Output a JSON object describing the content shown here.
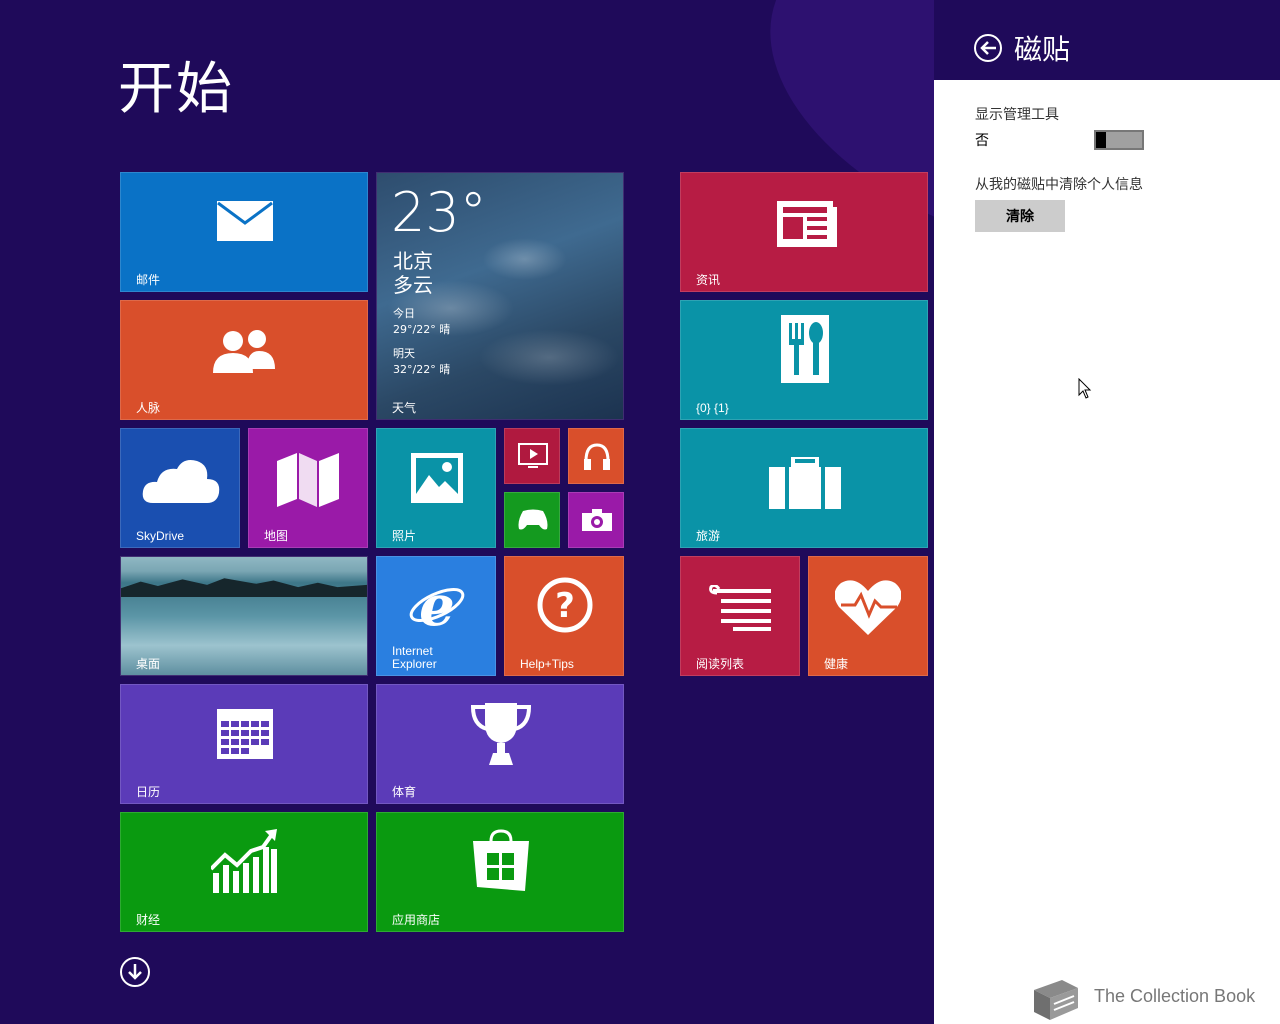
{
  "start": {
    "title": "开始"
  },
  "tiles": {
    "mail": "邮件",
    "people": "人脉",
    "weather": {
      "temp": "23°",
      "city": "北京",
      "condition": "多云",
      "today_label": "今日",
      "today_value": "29°/22° 晴",
      "tomorrow_label": "明天",
      "tomorrow_value": "32°/22° 晴",
      "label": "天气"
    },
    "skydrive": "SkyDrive",
    "maps": "地图",
    "photos": "照片",
    "desktop": "桌面",
    "ie_line1": "Internet",
    "ie_line2": "Explorer",
    "help": "Help+Tips",
    "calendar": "日历",
    "sports": "体育",
    "finance": "财经",
    "store": "应用商店",
    "news": "资讯",
    "food": "{0} {1}",
    "travel": "旅游",
    "reading_list": "阅读列表",
    "health": "健康"
  },
  "pane": {
    "title": "磁贴",
    "admin_tools_label": "显示管理工具",
    "admin_tools_value": "否",
    "clear_info_label": "从我的磁贴中清除个人信息",
    "clear_button": "清除"
  },
  "watermark": "The Collection Book",
  "colors": {
    "background": "#1f0a5a",
    "mail": "#0a72c6",
    "people": "#d94f2b",
    "skydrive": "#1a4fb0",
    "maps": "#9a1aa8",
    "photos": "#0a93a7",
    "video": "#b0193f",
    "music": "#d94f2b",
    "games": "#149a1f",
    "camera": "#9a1aa8",
    "ie": "#2a7fe0",
    "help": "#d94f2b",
    "calendar": "#5b3bb8",
    "sports": "#5b3bb8",
    "finance": "#0a9a10",
    "store": "#0a9a10",
    "news": "#b71c44",
    "food": "#0a93a7",
    "travel": "#0a93a7",
    "reading_list": "#b71c44",
    "health": "#d94f2b"
  }
}
